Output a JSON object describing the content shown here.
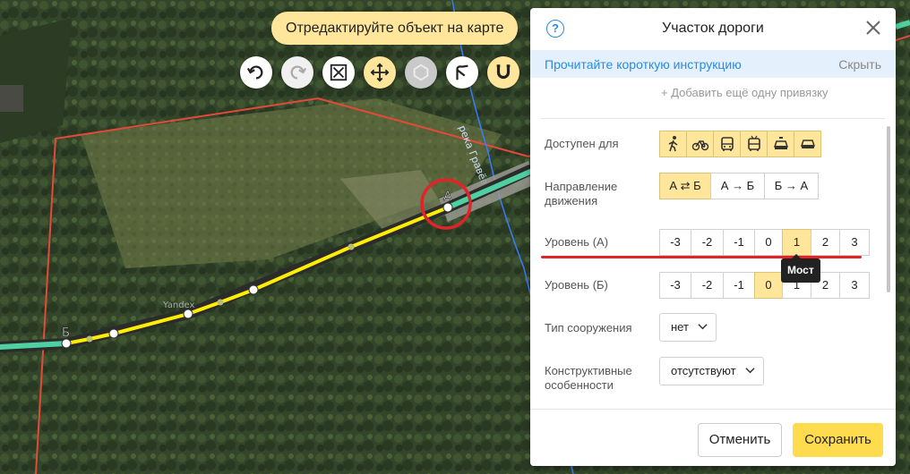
{
  "map": {
    "hint": "Отредактируйте объект на карте",
    "river_label": "река Гравёвка",
    "point_a": "А",
    "point_b": "Б",
    "watermark": "Yandex",
    "tools": [
      {
        "icon": "undo-icon",
        "state": "normal"
      },
      {
        "icon": "redo-icon",
        "state": "disabled"
      },
      {
        "icon": "select-area-icon",
        "state": "normal"
      },
      {
        "icon": "move-icon",
        "state": "active"
      },
      {
        "icon": "polygon-icon",
        "state": "disabled"
      },
      {
        "icon": "branch-icon",
        "state": "normal"
      },
      {
        "icon": "magnet-icon",
        "state": "active"
      }
    ]
  },
  "panel": {
    "title": "Участок дороги",
    "instruction_link": "Прочитайте короткую инструкцию",
    "hide_label": "Скрыть",
    "add_binding": "+ Добавить ещё одну привязку",
    "access_label": "Доступен для",
    "access_modes": [
      "pedestrian-icon",
      "bicycle-icon",
      "bus-icon",
      "trolleybus-icon",
      "taxi-icon",
      "car-icon"
    ],
    "direction_label": "Направление движения",
    "direction_options": [
      "А ⇄ Б",
      "А → Б",
      "Б → А"
    ],
    "direction_selected": 0,
    "level_a_label": "Уровень (А)",
    "level_b_label": "Уровень (Б)",
    "levels": [
      "-3",
      "-2",
      "-1",
      "0",
      "1",
      "2",
      "3"
    ],
    "level_a_selected": 4,
    "level_b_selected": 3,
    "tooltip": "Мост",
    "structure_label": "Тип сооружения",
    "structure_value": "нет",
    "features_label": "Конструктивные особенности",
    "features_value": "отсутствуют",
    "cancel": "Отменить",
    "save": "Сохранить"
  },
  "colors": {
    "accent_yellow": "#ffe69a",
    "save_yellow": "#ffdb4d",
    "link_blue": "#2a8be0",
    "red_annotation": "#e0242a"
  }
}
